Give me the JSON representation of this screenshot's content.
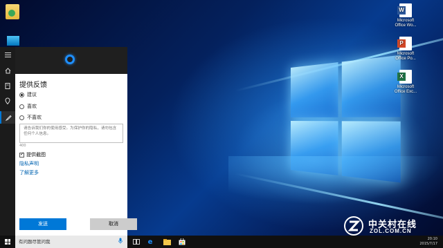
{
  "desktop": {
    "icons": [
      {
        "label": "Microsoft Office Wo...",
        "badge": "W",
        "kind": "word"
      },
      {
        "label": "Microsoft Office Po...",
        "badge": "P",
        "kind": "ppt"
      },
      {
        "label": "Microsoft Office Exc...",
        "badge": "X",
        "kind": "xls"
      }
    ]
  },
  "feedback": {
    "title": "提供反馈",
    "options": [
      {
        "label": "建议",
        "selected": true
      },
      {
        "label": "喜欢",
        "selected": false
      },
      {
        "label": "不喜欢",
        "selected": false
      }
    ],
    "textarea_placeholder": "请告诉我们你的使用感受。为保护你的隐私，请勿包含任何个人信息。",
    "char_counter": "400",
    "screenshot_checkbox_label": "提供截图",
    "screenshot_checked": true,
    "privacy_link": "隐私声明",
    "learn_more_link": "了解更多",
    "send_button": "发送",
    "cancel_button": "取消"
  },
  "taskbar": {
    "search_text": "有问题尽管问我",
    "time": "20:10",
    "date": "2015/7/17"
  },
  "watermark": {
    "chinese": "中关村在线",
    "english": "ZOL.COM.CN"
  },
  "colors": {
    "accent": "#0078d7",
    "link": "#0063b1",
    "panel_bg": "#ffffff",
    "sidebar_bg": "#1b1b1b",
    "taskbar_bg": "#101010"
  }
}
